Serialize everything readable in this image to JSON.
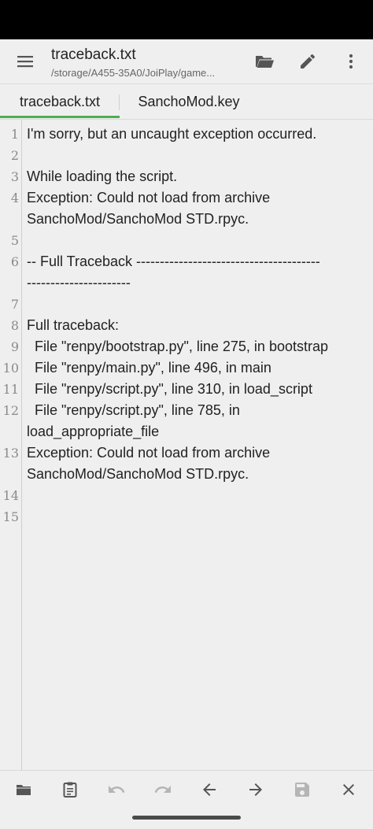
{
  "header": {
    "title": "traceback.txt",
    "subtitle": "/storage/A455-35A0/JoiPlay/game...",
    "menu_icon": "hamburger-menu-icon",
    "open_icon": "folder-open-icon",
    "edit_icon": "pencil-icon",
    "more_icon": "more-vert-icon"
  },
  "tabs": [
    {
      "label": "traceback.txt",
      "active": true
    },
    {
      "label": "SanchoMod.key",
      "active": false
    }
  ],
  "editor": {
    "lines": [
      {
        "num": "1",
        "text": "I'm sorry, but an uncaught exception occurred."
      },
      {
        "num": "2",
        "text": ""
      },
      {
        "num": "3",
        "text": "While loading the script."
      },
      {
        "num": "4",
        "text": "Exception: Could not load from archive"
      },
      {
        "num": "",
        "text": "SanchoMod/SanchoMod STD.rpyc."
      },
      {
        "num": "5",
        "text": ""
      },
      {
        "num": "6",
        "text": "-- Full Traceback ---------------------------------------"
      },
      {
        "num": "",
        "text": "----------------------"
      },
      {
        "num": "7",
        "text": ""
      },
      {
        "num": "8",
        "text": "Full traceback:"
      },
      {
        "num": "9",
        "text": "  File \"renpy/bootstrap.py\", line 275, in bootstrap"
      },
      {
        "num": "10",
        "text": "  File \"renpy/main.py\", line 496, in main"
      },
      {
        "num": "11",
        "text": "  File \"renpy/script.py\", line 310, in load_script"
      },
      {
        "num": "12",
        "text": "  File \"renpy/script.py\", line 785, in"
      },
      {
        "num": "",
        "text": "load_appropriate_file"
      },
      {
        "num": "13",
        "text": "Exception: Could not load from archive"
      },
      {
        "num": "",
        "text": "SanchoMod/SanchoMod STD.rpyc."
      },
      {
        "num": "14",
        "text": ""
      },
      {
        "num": "15",
        "text": ""
      }
    ]
  },
  "toolbar": {
    "icons": [
      "folder-icon",
      "clipboard-icon",
      "undo-icon",
      "redo-icon",
      "arrow-left-icon",
      "arrow-right-icon",
      "save-icon",
      "close-icon"
    ]
  },
  "colors": {
    "accent": "#4caf50",
    "background": "#efefef",
    "text": "#222222",
    "line_number": "#8a8a8a",
    "icon": "#555555",
    "icon_disabled": "#b5b5b5"
  }
}
